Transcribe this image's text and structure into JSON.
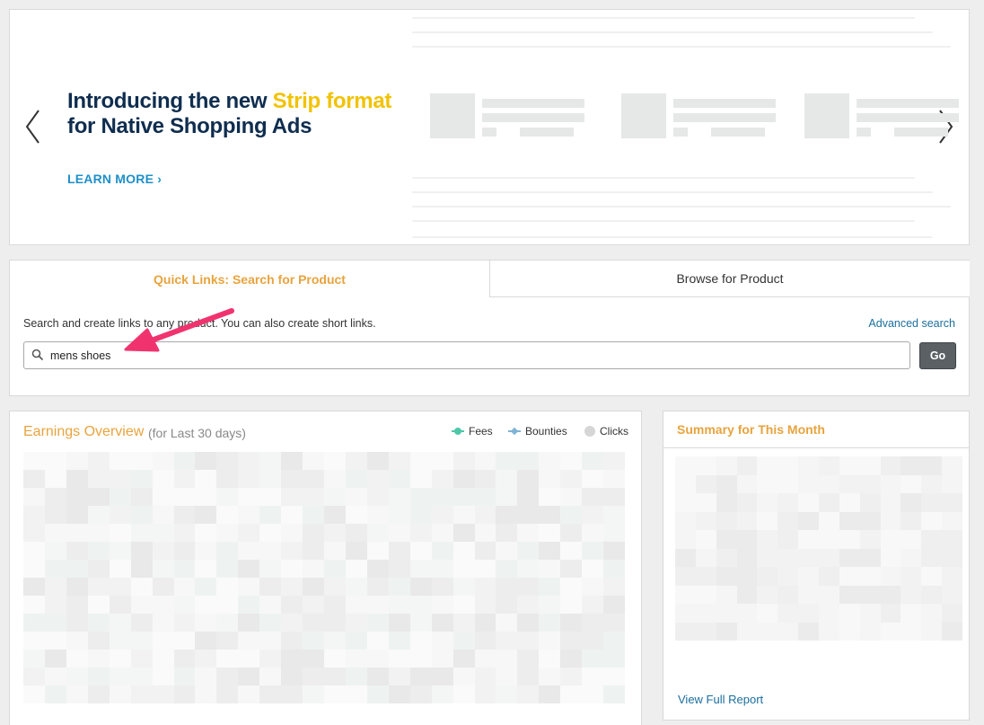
{
  "banner": {
    "headline_line1_prefix": "Introducing the new ",
    "headline_accent": "Strip format",
    "headline_line2": "for Native Shopping Ads",
    "learn_more": "LEARN MORE ›",
    "prev_icon": "chevron-left-icon",
    "next_icon": "chevron-right-icon"
  },
  "search": {
    "tabs": [
      {
        "label": "Quick Links: Search for Product",
        "active": true
      },
      {
        "label": "Browse for Product",
        "active": false
      }
    ],
    "description": "Search and create links to any product. You can also create short links.",
    "advanced_link": "Advanced search",
    "input_value": "mens shoes",
    "button_label": "Go"
  },
  "earnings": {
    "title": "Earnings Overview",
    "subtitle": "(for Last 30 days)",
    "legend": [
      {
        "label": "Fees",
        "color": "#4dc7a8"
      },
      {
        "label": "Bounties",
        "color": "#7eb3d4"
      },
      {
        "label": "Clicks",
        "color": "#d6d6d6"
      }
    ]
  },
  "summary": {
    "title": "Summary for This Month",
    "view_report": "View Full Report"
  },
  "colors": {
    "accent_orange": "#e8a33d",
    "link_blue": "#1a6f9d",
    "headline_navy": "#0f2d4f",
    "headline_yellow": "#f2c200",
    "annotation_pink": "#f0336f"
  }
}
